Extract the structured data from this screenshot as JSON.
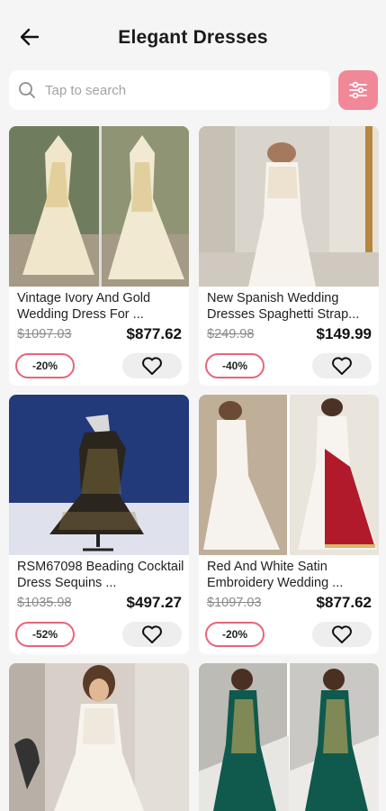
{
  "header": {
    "title": "Elegant Dresses"
  },
  "search": {
    "placeholder": "Tap to search"
  },
  "products": [
    {
      "name": "Vintage Ivory And Gold Wedding Dress For ...",
      "old_price": "$1097.03",
      "price": "$877.62",
      "discount": "-20%"
    },
    {
      "name": "New Spanish Wedding Dresses Spaghetti Strap...",
      "old_price": "$249.98",
      "price": "$149.99",
      "discount": "-40%"
    },
    {
      "name": "RSM67098 Beading Cocktail Dress Sequins ...",
      "old_price": "$1035.98",
      "price": "$497.27",
      "discount": "-52%"
    },
    {
      "name": "Red And White Satin Embroidery Wedding ...",
      "old_price": "$1097.03",
      "price": "$877.62",
      "discount": "-20%"
    }
  ],
  "colors": {
    "accent": "#f08898",
    "discount_border": "#e8647a",
    "background": "#f5f5f5"
  },
  "icons": {
    "back": "arrow-left-icon",
    "search": "search-icon",
    "filter": "filter-sliders-icon",
    "favorite": "heart-outline-icon"
  }
}
